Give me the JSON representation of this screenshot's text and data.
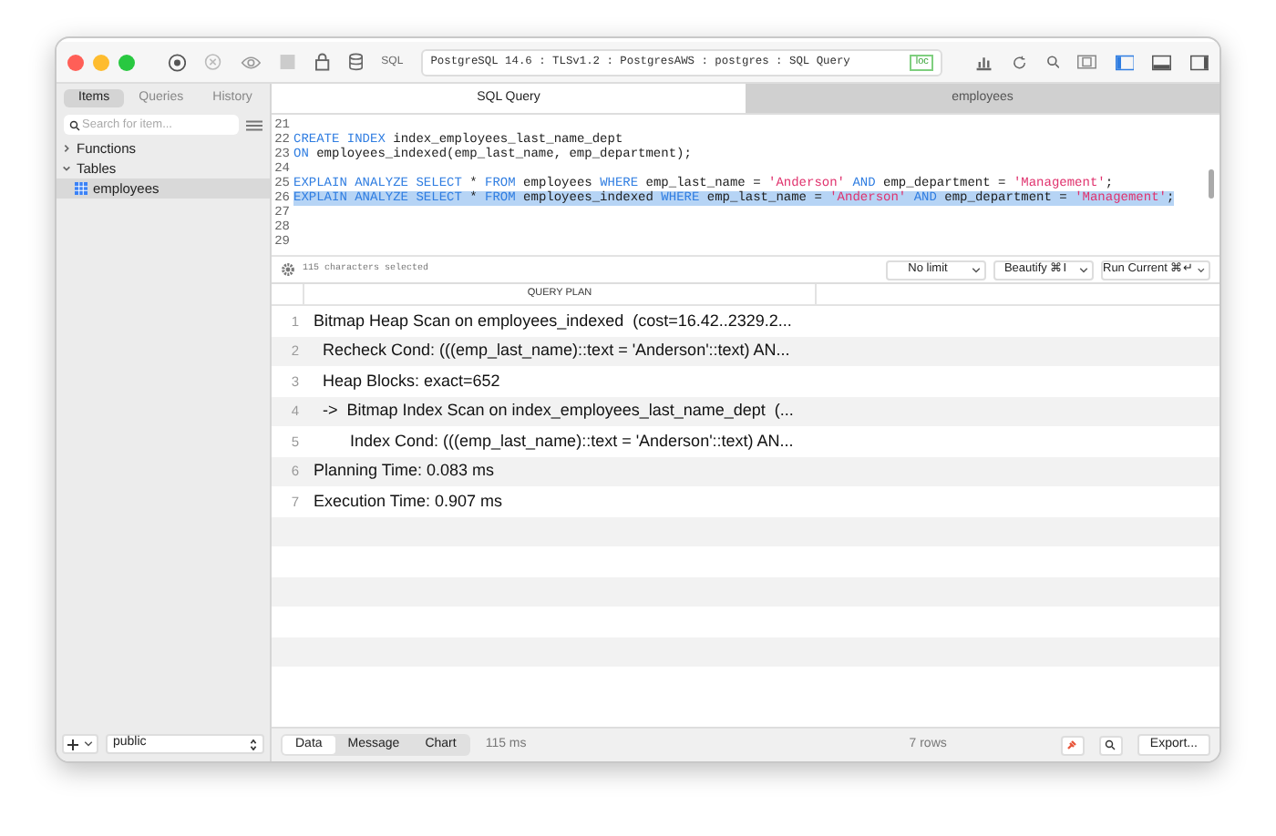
{
  "toolbar": {
    "sql_label": "SQL",
    "connection": "PostgreSQL 14.6 : TLSv1.2 : PostgresAWS : postgres : SQL Query",
    "badge": "loc"
  },
  "sidebar": {
    "segments": [
      {
        "label": "Items",
        "selected": true
      },
      {
        "label": "Queries",
        "selected": false
      },
      {
        "label": "History",
        "selected": false
      }
    ],
    "search": {
      "placeholder": "Search for item..."
    },
    "tree": [
      {
        "label": "Functions",
        "expanded": false
      },
      {
        "label": "Tables",
        "expanded": true,
        "children": [
          {
            "label": "employees",
            "selected": true
          }
        ]
      }
    ],
    "schema": "public"
  },
  "tabs": [
    {
      "label": "SQL Query",
      "selected": true
    },
    {
      "label": "employees",
      "selected": false
    }
  ],
  "editor": {
    "lines": [
      {
        "number": "21",
        "selected": false
      },
      {
        "number": "22",
        "selected": false,
        "tokens": [
          {
            "kind": "keyword",
            "text": "CREATE INDEX"
          },
          {
            "kind": "plain",
            "text": " index_employees_last_name_dept"
          }
        ]
      },
      {
        "number": "23",
        "selected": false,
        "tokens": [
          {
            "kind": "keyword",
            "text": "ON"
          },
          {
            "kind": "plain",
            "text": " employees_indexed(emp_last_name, emp_department);"
          }
        ]
      },
      {
        "number": "24",
        "selected": false
      },
      {
        "number": "25",
        "selected": false,
        "tokens": [
          {
            "kind": "keyword",
            "text": "EXPLAIN ANALYZE SELECT"
          },
          {
            "kind": "plain",
            "text": " * "
          },
          {
            "kind": "keyword",
            "text": "FROM"
          },
          {
            "kind": "plain",
            "text": " employees "
          },
          {
            "kind": "keyword",
            "text": "WHERE"
          },
          {
            "kind": "plain",
            "text": " emp_last_name = "
          },
          {
            "kind": "string",
            "text": "'Anderson'"
          },
          {
            "kind": "space"
          },
          {
            "kind": "keyword",
            "text": "AND"
          },
          {
            "kind": "plain",
            "text": " emp_department = "
          },
          {
            "kind": "string",
            "text": "'Management'"
          },
          {
            "kind": "plain",
            "text": ";"
          }
        ]
      },
      {
        "number": "26",
        "selected": true,
        "tokens": [
          {
            "kind": "keyword",
            "text": "EXPLAIN ANALYZE SELECT"
          },
          {
            "kind": "plain",
            "text": " * "
          },
          {
            "kind": "keyword",
            "text": "FROM"
          },
          {
            "kind": "plain",
            "text": " employees_indexed "
          },
          {
            "kind": "keyword",
            "text": "WHERE"
          },
          {
            "kind": "plain",
            "text": " emp_last_name = "
          },
          {
            "kind": "string",
            "text": "'Anderson'"
          },
          {
            "kind": "space"
          },
          {
            "kind": "keyword",
            "text": "AND"
          },
          {
            "kind": "plain",
            "text": " emp_department = "
          },
          {
            "kind": "string",
            "text": "'Management'"
          },
          {
            "kind": "plain",
            "text": ";"
          }
        ]
      },
      {
        "number": "27",
        "selected": false
      },
      {
        "number": "28",
        "selected": false
      },
      {
        "number": "29",
        "selected": false
      }
    ],
    "status": "115 characters selected",
    "buttons": [
      "No limit",
      "Beautify ⌘I",
      "Run Current ⌘↵"
    ]
  },
  "results": {
    "columns": [
      "QUERY PLAN"
    ],
    "rows": [
      {
        "number": "1",
        "text": "Bitmap Heap Scan on employees_indexed  (cost=16.42..2329.2..."
      },
      {
        "number": "2",
        "text": "  Recheck Cond: (((emp_last_name)::text = 'Anderson'::text) AN..."
      },
      {
        "number": "3",
        "text": "  Heap Blocks: exact=652"
      },
      {
        "number": "4",
        "text": "  ->  Bitmap Index Scan on index_employees_last_name_dept  (..."
      },
      {
        "number": "5",
        "text": "        Index Cond: (((emp_last_name)::text = 'Anderson'::text) AN..."
      },
      {
        "number": "6",
        "text": "Planning Time: 0.083 ms"
      },
      {
        "number": "7",
        "text": "Execution Time: 0.907 ms"
      }
    ]
  },
  "bottom_bar": {
    "segments": [
      {
        "label": "Data",
        "selected": true
      },
      {
        "label": "Message",
        "selected": false
      },
      {
        "label": "Chart",
        "selected": false
      }
    ],
    "time": "115 ms",
    "row_count": "7 rows",
    "export": "Export..."
  }
}
